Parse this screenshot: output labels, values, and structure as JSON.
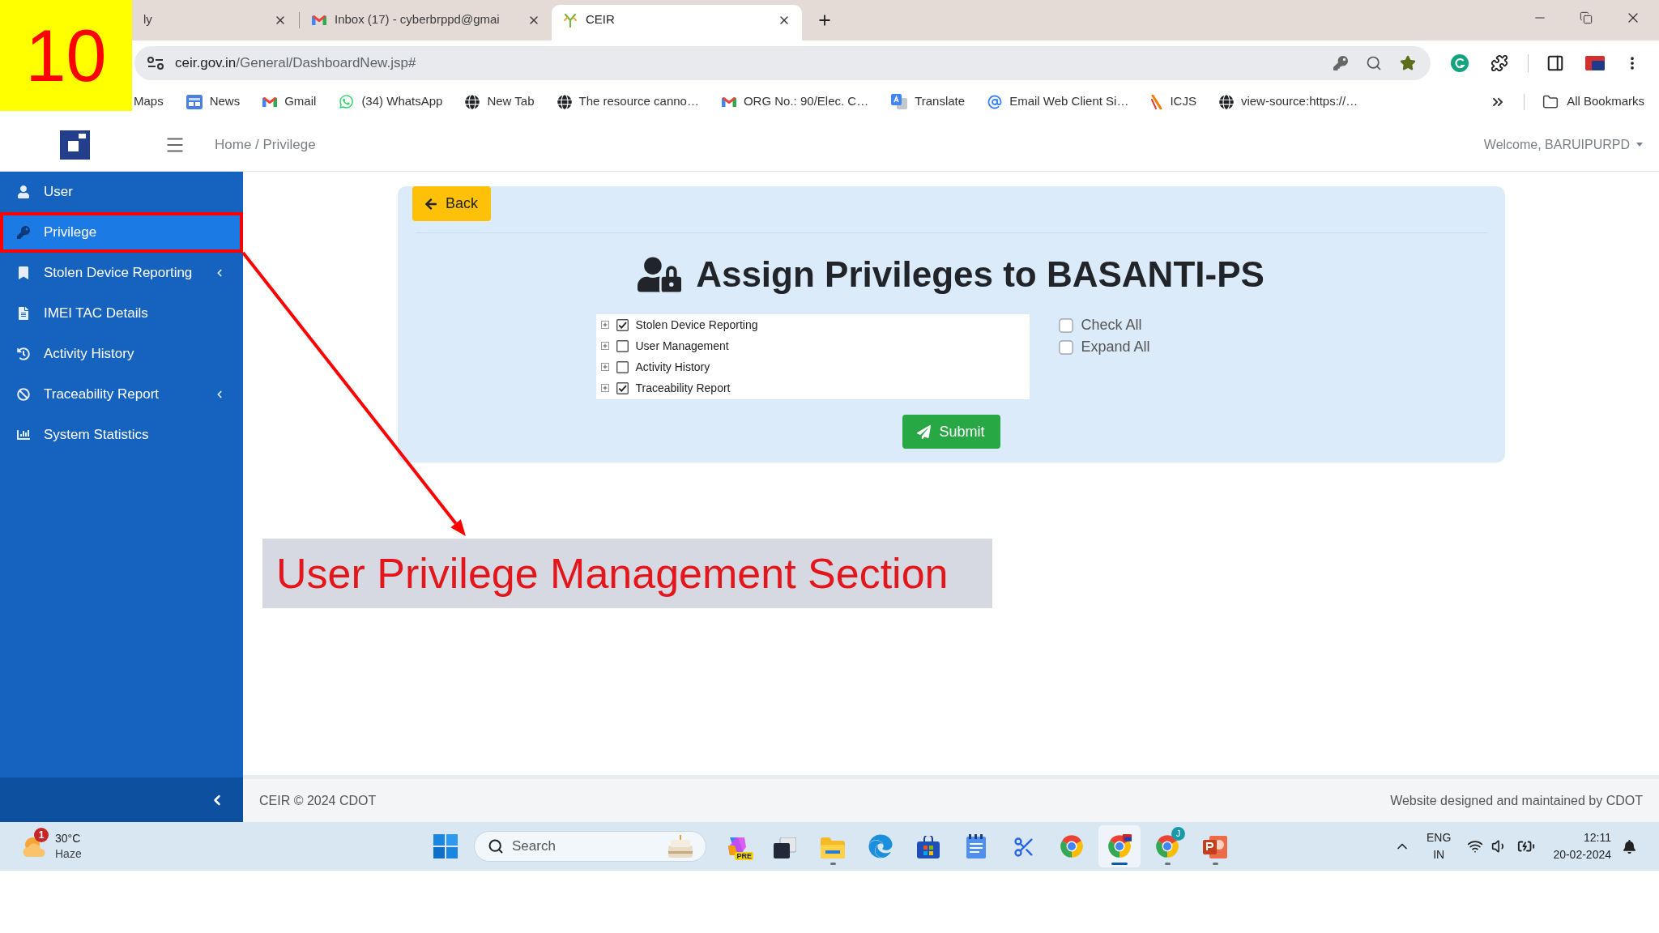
{
  "browser": {
    "tabs": [
      {
        "title": "ly",
        "selected": false
      },
      {
        "title": "Inbox (17) - cyberbrppd@gmai",
        "selected": false
      },
      {
        "title": "CEIR",
        "selected": true
      }
    ],
    "address": {
      "domain": "ceir.gov.in",
      "path": "/General/DashboardNew.jsp#"
    },
    "bookmarks": [
      "Maps",
      "News",
      "Gmail",
      "(34) WhatsApp",
      "New Tab",
      "The resource canno…",
      "ORG No.: 90/Elec. C…",
      "Translate",
      "Email Web Client Si…",
      "ICJS",
      "view-source:https://…"
    ],
    "all_bookmarks": "All Bookmarks"
  },
  "header": {
    "breadcrumb": "Home / Privilege",
    "welcome": "Welcome, BARUIPURPD"
  },
  "sidebar": {
    "items": [
      {
        "label": "User",
        "selected": false,
        "submenu": false
      },
      {
        "label": "Privilege",
        "selected": true,
        "submenu": false
      },
      {
        "label": "Stolen Device Reporting",
        "selected": false,
        "submenu": true
      },
      {
        "label": "IMEI TAC Details",
        "selected": false,
        "submenu": false
      },
      {
        "label": "Activity History",
        "selected": false,
        "submenu": false
      },
      {
        "label": "Traceability Report",
        "selected": false,
        "submenu": true
      },
      {
        "label": "System Statistics",
        "selected": false,
        "submenu": false
      }
    ]
  },
  "panel": {
    "back_button": "Back",
    "heading": "Assign Privileges to BASANTI-PS",
    "privileges": [
      {
        "label": "Stolen Device Reporting",
        "checked": true,
        "expanded": false
      },
      {
        "label": "User Management",
        "checked": false,
        "expanded": false
      },
      {
        "label": "Activity History",
        "checked": false,
        "expanded": false
      },
      {
        "label": "Traceability Report",
        "checked": true,
        "expanded": false
      }
    ],
    "options": [
      {
        "label": "Check All",
        "checked": false
      },
      {
        "label": "Expand All",
        "checked": false
      }
    ],
    "submit_button": "Submit"
  },
  "footer": {
    "left": "CEIR © 2024 CDOT",
    "right": "Website designed and maintained by CDOT"
  },
  "taskbar": {
    "weather": {
      "temperature": "30°C",
      "condition": "Haze",
      "badge": "1"
    },
    "search": {
      "placeholder": "Search"
    },
    "apps": [
      {
        "running": false,
        "selected": false,
        "badge": "PRE"
      },
      {
        "running": false,
        "selected": false
      },
      {
        "running": true,
        "selected": false
      },
      {
        "running": false,
        "selected": false
      },
      {
        "running": false,
        "selected": false
      },
      {
        "running": false,
        "selected": false
      },
      {
        "running": false,
        "selected": false
      },
      {
        "running": false,
        "selected": false
      },
      {
        "running": true,
        "selected": true
      },
      {
        "running": true,
        "selected": false,
        "badge": "J"
      },
      {
        "running": true,
        "selected": false
      }
    ],
    "language": {
      "code": "ENG",
      "region": "IN"
    },
    "time": "12:11",
    "date": "20-02-2024"
  },
  "annotation": {
    "step": "10",
    "caption": "User Privilege Management Section"
  }
}
